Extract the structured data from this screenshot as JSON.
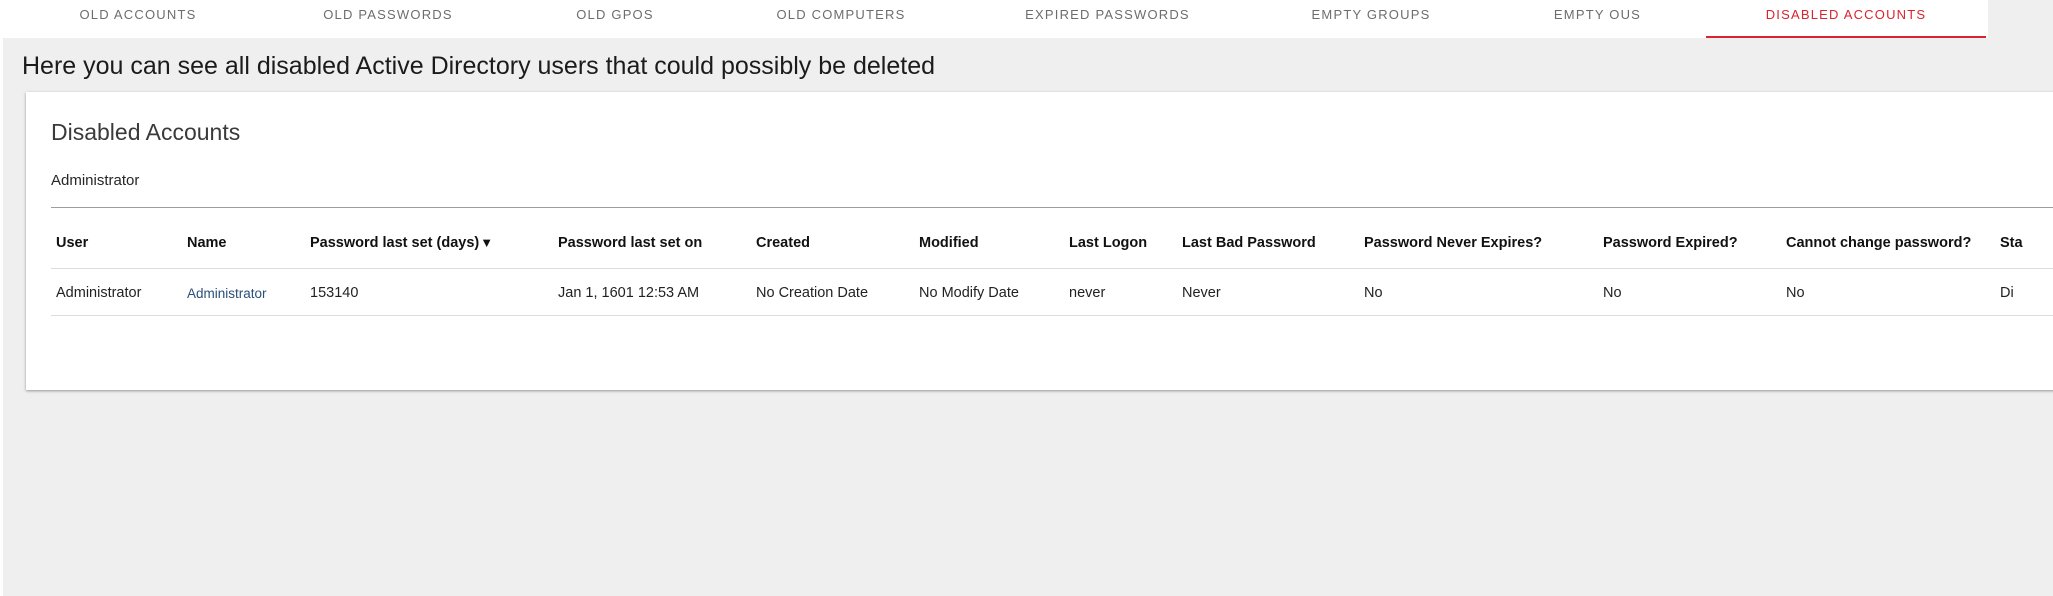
{
  "tabs": [
    {
      "label": "OLD ACCOUNTS",
      "active": false
    },
    {
      "label": "OLD PASSWORDS",
      "active": false
    },
    {
      "label": "OLD GPOS",
      "active": false
    },
    {
      "label": "OLD COMPUTERS",
      "active": false
    },
    {
      "label": "EXPIRED PASSWORDS",
      "active": false
    },
    {
      "label": "EMPTY GROUPS",
      "active": false
    },
    {
      "label": "EMPTY OUS",
      "active": false
    },
    {
      "label": "DISABLED ACCOUNTS",
      "active": true
    }
  ],
  "heading": "Here you can see all disabled Active Directory users that could possibly be deleted",
  "card": {
    "title": "Disabled Accounts",
    "subtitle": "Administrator"
  },
  "table": {
    "sort_icon": "▼",
    "columns": [
      "User",
      "Name",
      "Password last set (days)",
      "Password last set on",
      "Created",
      "Modified",
      "Last Logon",
      "Last Bad Password",
      "Password Never Expires?",
      "Password Expired?",
      "Cannot change password?",
      "Sta"
    ],
    "rows": [
      [
        "Administrator",
        "Administrator",
        "153140",
        "Jan 1, 1601 12:53 AM",
        "No Creation Date",
        "No Modify Date",
        "never",
        "Never",
        "No",
        "No",
        "No",
        "Di"
      ]
    ]
  },
  "colors": {
    "accent": "#d9232f",
    "link": "#2b4f7a"
  }
}
